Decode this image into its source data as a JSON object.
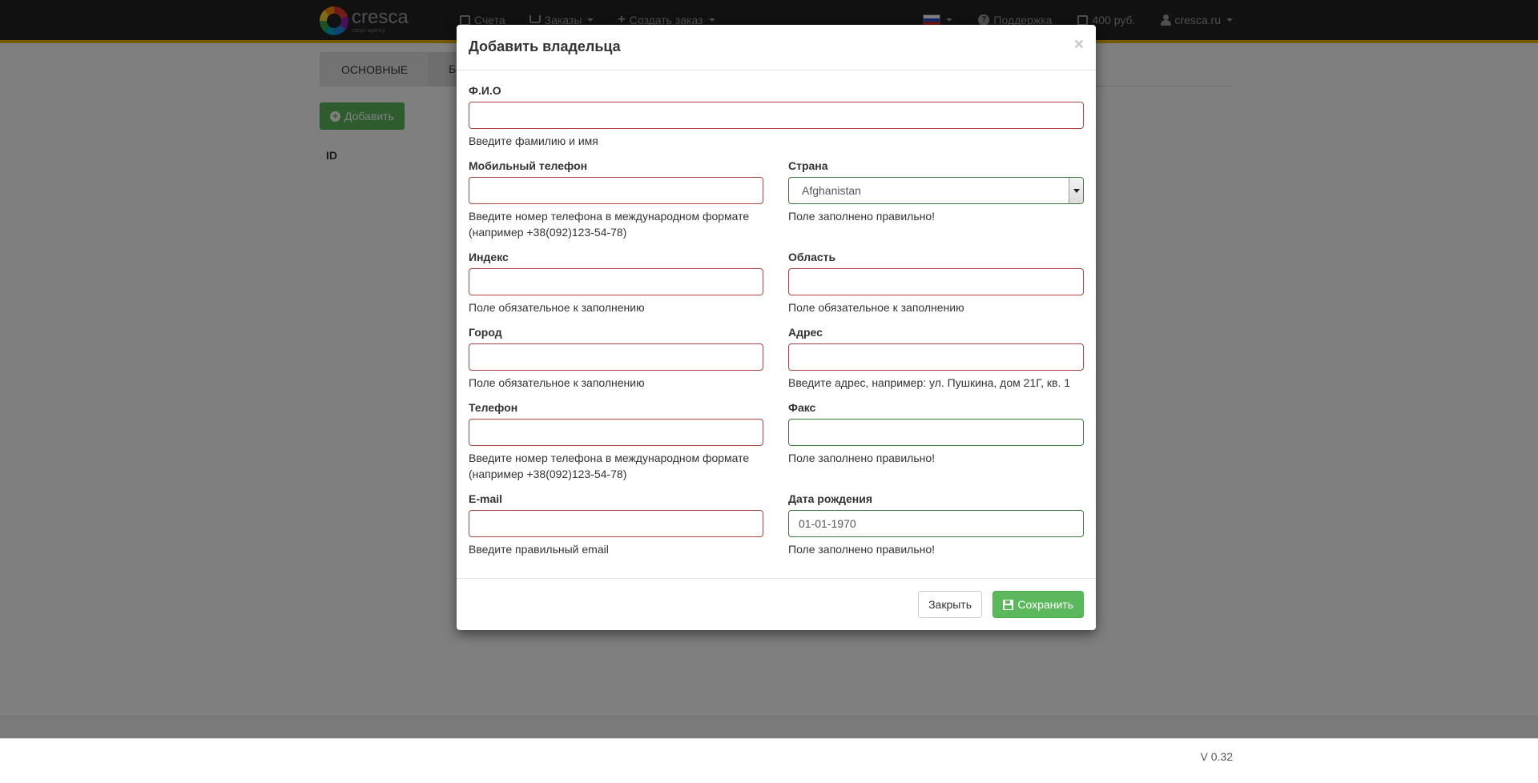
{
  "brand": {
    "name": "cresca",
    "tagline": "cargo agency"
  },
  "nav": {
    "invoices": "Счета",
    "orders": "Заказы",
    "create_order": "Создать заказ",
    "support": "Поддержка",
    "balance": "400 руб.",
    "account": "cresca.ru"
  },
  "tabs": {
    "main": "ОСНОВНЫЕ",
    "second": "Б"
  },
  "page": {
    "add_button": "Добавить",
    "table_header_id": "ID"
  },
  "footer": {
    "version": "V 0.32"
  },
  "colors": {
    "error_border": "#a94442",
    "success_border": "#3c763d",
    "save_button": "#5cb85c",
    "accent": "#f0b100"
  },
  "modal": {
    "title": "Добавить владельца",
    "close_symbol": "×",
    "fields": {
      "fio": {
        "label": "Ф.И.О",
        "value": "",
        "help": "Введите фамилию и имя"
      },
      "mobile": {
        "label": "Мобильный телефон",
        "value": "",
        "help": "Введите номер телефона в международном формате (например +38(092)123-54-78)"
      },
      "country": {
        "label": "Страна",
        "value": "Afghanistan",
        "help": "Поле заполнено правильно!"
      },
      "zip": {
        "label": "Индекс",
        "value": "",
        "help": "Поле обязательное к заполнению"
      },
      "region": {
        "label": "Область",
        "value": "",
        "help": "Поле обязательное к заполнению"
      },
      "city": {
        "label": "Город",
        "value": "",
        "help": "Поле обязательное к заполнению"
      },
      "address": {
        "label": "Адрес",
        "value": "",
        "help": "Введите адрес, например: ул. Пушкина, дом 21Г, кв. 1"
      },
      "phone": {
        "label": "Телефон",
        "value": "",
        "help": "Введите номер телефона в международном формате (например +38(092)123-54-78)"
      },
      "fax": {
        "label": "Факс",
        "value": "",
        "help": "Поле заполнено правильно!"
      },
      "email": {
        "label": "E-mail",
        "value": "",
        "help": "Введите правильный email"
      },
      "birthdate": {
        "label": "Дата рождения",
        "value": "01-01-1970",
        "help": "Поле заполнено правильно!"
      }
    },
    "buttons": {
      "close": "Закрыть",
      "save": "Сохранить"
    }
  }
}
